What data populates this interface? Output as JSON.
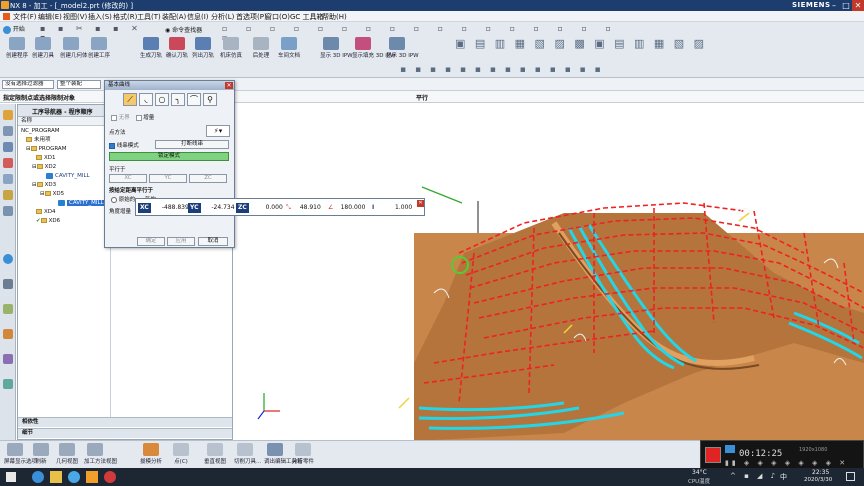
{
  "window": {
    "title": "NX 8 - 加工 - [_model2.prt  (修改的) ]",
    "brand": "SIEMENS",
    "controls": [
      "–",
      "□",
      "✕"
    ]
  },
  "menu": [
    "文件(F)",
    "编辑(E)",
    "视图(V)",
    "插入(S)",
    "格式(R)",
    "工具(T)",
    "装配(A)",
    "信息(I)",
    "分析(L)",
    "首选项(P)",
    "窗口(O)",
    "GC 工具箱",
    "帮助(H)"
  ],
  "toolbar": {
    "start_label": "开始",
    "row1_right": "命令查找器",
    "groups": [
      {
        "label": "创建程序"
      },
      {
        "label": "创建刀具"
      },
      {
        "label": "创建几何体"
      },
      {
        "label": "创建工序"
      },
      {
        "label": "生成刀轨"
      },
      {
        "label": "确认刀轨"
      },
      {
        "label": "列出刀轨"
      },
      {
        "label": "机床仿真"
      },
      {
        "label": "后处理"
      },
      {
        "label": "车间文档"
      },
      {
        "label": "显示 3D IPW"
      },
      {
        "label": "显示填充 3D IPW"
      },
      {
        "label": "显示 3D IPW"
      }
    ]
  },
  "filterbar": {
    "filter_value": "没有选择过滤器",
    "scope_value": "整个装配"
  },
  "statusbar": {
    "prompt": "指定限制点或选择限制对象",
    "center": "平行"
  },
  "navigator": {
    "title": "工序导航器 - 程序顺序",
    "column_header": "名称",
    "rows": [
      {
        "label": "NC_PROGRAM",
        "indent": 0,
        "kind": "root"
      },
      {
        "label": "未用项",
        "indent": 1,
        "kind": "folder"
      },
      {
        "label": "PROGRAM",
        "indent": 1,
        "kind": "folder"
      },
      {
        "label": "XD1",
        "indent": 2,
        "kind": "folder"
      },
      {
        "label": "XD2",
        "indent": 2,
        "kind": "folder"
      },
      {
        "label": "CAVITY_MILL",
        "indent": 3,
        "kind": "op"
      },
      {
        "label": "XD3",
        "indent": 2,
        "kind": "folder"
      },
      {
        "label": "XD5",
        "indent": 3,
        "kind": "folder"
      },
      {
        "label": "CAVITY_MILL",
        "indent": 4,
        "kind": "op-selected"
      },
      {
        "label": "XD4",
        "indent": 2,
        "kind": "folder"
      },
      {
        "label": "XD6",
        "indent": 2,
        "kind": "folder"
      }
    ],
    "footer": [
      "相依性",
      "细节"
    ]
  },
  "dialog": {
    "title": "基本曲线",
    "checkbox_unbounded": "无界",
    "checkbox_incremental": "增量",
    "point_method_label": "点方法",
    "string_mode_label": "线串模式",
    "break_string_button": "打断线串",
    "lock_mode_button": "锁定模式",
    "parallel_to_label": "平行于",
    "parallel_buttons": [
      "XC",
      "YC",
      "ZC"
    ],
    "angle_section": "按给定距离平行于",
    "radio_original": "原始的",
    "radio_new": "新的",
    "angle_increment_label": "角度增量",
    "ok": "确定",
    "apply": "应用",
    "cancel": "取消"
  },
  "coordbar": {
    "xc_label": "XC",
    "xc_value": "-488.839",
    "yc_label": "YC",
    "yc_value": "-24.734",
    "zc_label": "ZC",
    "zc_value": "0.000",
    "length_value": "48.910",
    "angle_value": "180.000",
    "offset_value": "1.000"
  },
  "bottom_toolbar": {
    "items": [
      "屏幕显示选项",
      "刷新",
      "几何视图",
      "加工方法视图",
      "拔模分析",
      "点(C)",
      "垂直视图",
      "切削刀具...",
      "调出编辑工具箱",
      "分析零件"
    ]
  },
  "recorder": {
    "timer": "00:12:25",
    "label": "1920x1080"
  },
  "taskbar": {
    "weather": "34°C",
    "weather_sub": "CPU温度",
    "time": "22:35",
    "date": "2020/3/30",
    "lang": "中"
  },
  "colors": {
    "title_bg": "#1c3d6e",
    "toolbar_bg": "#e4e9ef",
    "part_surface": "#c8864a",
    "toolpath_red": "#ee2222",
    "toolpath_cyan": "#22d6e8",
    "selection_blue": "#2b7fd0",
    "lock_green": "#7fd27f"
  }
}
